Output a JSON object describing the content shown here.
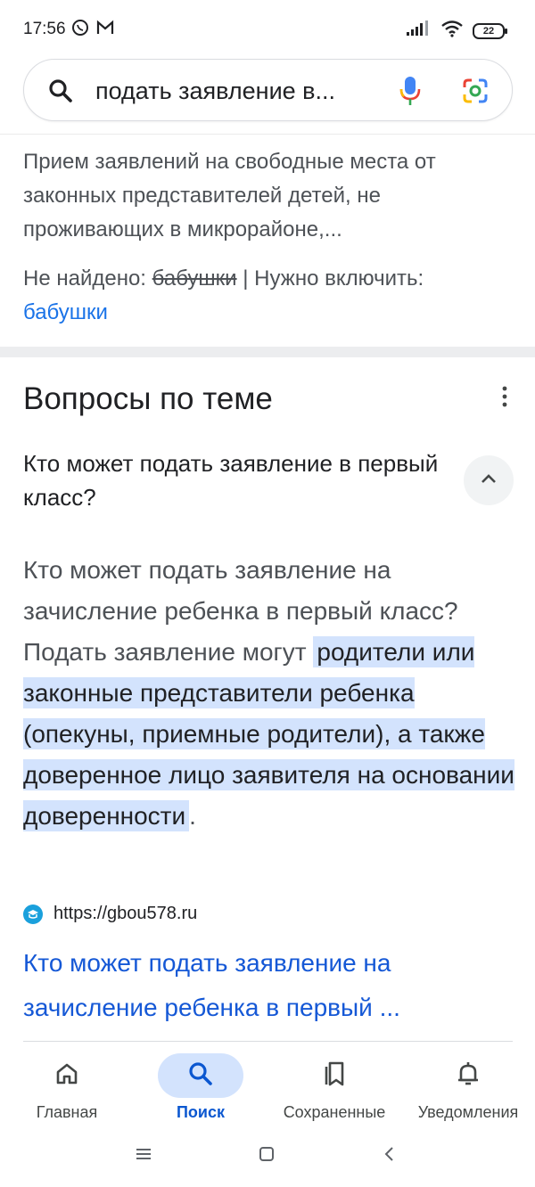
{
  "status_bar": {
    "time": "17:56",
    "battery": "22",
    "icons": [
      "viber-icon",
      "gmail-icon",
      "signal-icon",
      "wifi-icon",
      "battery-icon"
    ]
  },
  "search": {
    "query": "подать заявление в...",
    "icons": [
      "search-icon",
      "mic-icon",
      "lens-icon"
    ]
  },
  "snippet": {
    "text": "Прием заявлений на свободные места от законных представителей детей, не проживающих в микрорайоне,...",
    "not_found_label": "Не найдено:",
    "not_found_term": "бабушки",
    "separator": "|",
    "must_include_label": "Нужно включить:",
    "must_include_term": "бабушки"
  },
  "paa": {
    "title": "Вопросы по теме",
    "question": "Кто может подать заявление в первый класс?",
    "answer_intro": "Кто может подать заявление на зачисление ребенка в первый класс? Подать заявление могут ",
    "answer_highlight": "родители или законные представители ребенка (опекуны, приемные родители), а также доверенное лицо заявителя на основании доверенности",
    "answer_end": ".",
    "source_url": "https://gbou578.ru",
    "result_title": "Кто может подать заявление на зачисление ребенка в первый ..."
  },
  "bottom_nav": {
    "items": [
      {
        "label": "Главная",
        "icon": "home-icon",
        "active": false
      },
      {
        "label": "Поиск",
        "icon": "search-icon",
        "active": true
      },
      {
        "label": "Сохраненные",
        "icon": "bookmarks-icon",
        "active": false
      },
      {
        "label": "Уведомления",
        "icon": "bell-icon",
        "active": false
      }
    ]
  },
  "colors": {
    "link": "#1558d6",
    "highlight": "#d3e3fd",
    "active_nav": "#0b57d0"
  }
}
